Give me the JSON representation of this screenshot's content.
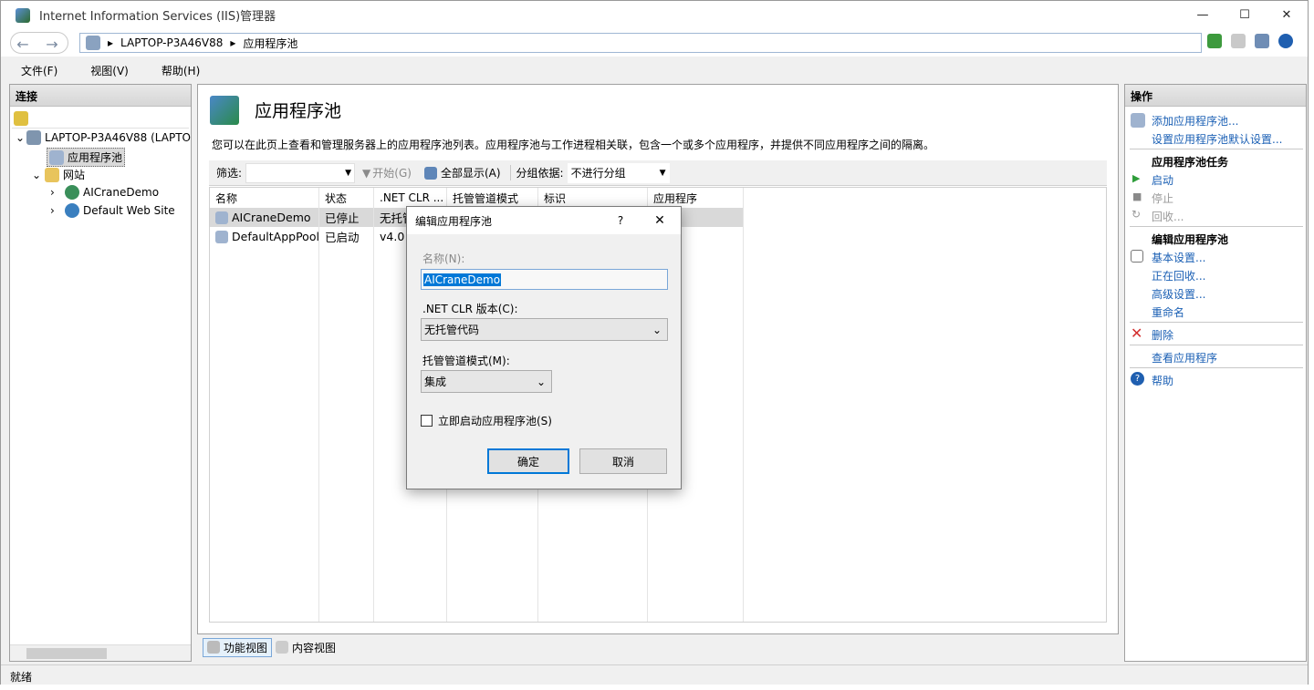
{
  "window": {
    "title": "Internet Information Services (IIS)管理器"
  },
  "address": {
    "crumbs": [
      "LAPTOP-P3A46V88",
      "应用程序池"
    ]
  },
  "menu": [
    "文件(F)",
    "视图(V)",
    "帮助(H)"
  ],
  "connections": {
    "title": "连接",
    "server": "LAPTOP-P3A46V88 (LAPTO",
    "apppools": "应用程序池",
    "sites": "网站",
    "site1": "AICraneDemo",
    "site2": "Default Web Site"
  },
  "main": {
    "title": "应用程序池",
    "desc": "您可以在此页上查看和管理服务器上的应用程序池列表。应用程序池与工作进程相关联，包含一个或多个应用程序，并提供不同应用程序之间的隔离。",
    "filter_label": "筛选:",
    "start_label": "开始(G)",
    "showall_label": "全部显示(A)",
    "groupby_label": "分组依据:",
    "groupby_value": "不进行分组",
    "columns": [
      "名称",
      "状态",
      ".NET CLR ...",
      "托管管道模式",
      "标识",
      "应用程序"
    ],
    "rows": [
      {
        "name": "AICraneDemo",
        "status": "已停止",
        "clr": "无托管"
      },
      {
        "name": "DefaultAppPool",
        "status": "已启动",
        "clr": "v4.0"
      }
    ],
    "tab_features": "功能视图",
    "tab_content": "内容视图"
  },
  "actions": {
    "title": "操作",
    "add": "添加应用程序池...",
    "defaults": "设置应用程序池默认设置...",
    "tasks_group": "应用程序池任务",
    "start": "启动",
    "stop": "停止",
    "recycle": "回收...",
    "edit_group": "编辑应用程序池",
    "basic": "基本设置...",
    "recycling": "正在回收...",
    "advanced": "高级设置...",
    "rename": "重命名",
    "delete": "删除",
    "view_apps": "查看应用程序",
    "help": "帮助"
  },
  "dialog": {
    "title": "编辑应用程序池",
    "help": "?",
    "name_label": "名称(N):",
    "name_value": "AICraneDemo",
    "clr_label": ".NET CLR 版本(C):",
    "clr_value": "无托管代码",
    "pipeline_label": "托管管道模式(M):",
    "pipeline_value": "集成",
    "start_checkbox": "立即启动应用程序池(S)",
    "ok": "确定",
    "cancel": "取消"
  },
  "status": "就绪",
  "colors": {
    "link": "#1a5fb4",
    "selection": "#0078d7",
    "delete": "#d32f2f",
    "start": "#2e9d3a"
  }
}
